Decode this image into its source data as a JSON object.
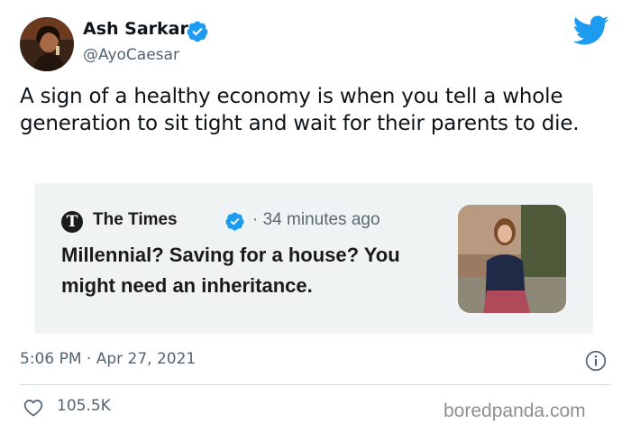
{
  "author": {
    "name": "Ash Sarkar",
    "handle": "@AyoCaesar",
    "verified_icon": "verified-badge-icon"
  },
  "platform_icon": "twitter-bird-icon",
  "tweet": {
    "text": "A sign of a healthy economy is when you tell a whole generation to sit tight and wait for their parents to die."
  },
  "embedded_card": {
    "source_logo_letter": "T",
    "source_name": "The Times",
    "time_ago": "· 34 minutes ago",
    "headline": "Millennial? Saving for a house? You might need an inheritance."
  },
  "meta": {
    "timestamp": "5:06 PM · Apr 27, 2021",
    "info_icon": "info-icon"
  },
  "actions": {
    "like_icon": "heart-icon",
    "like_count": "105.5K"
  },
  "watermark": "boredpanda.com",
  "colors": {
    "twitter_blue": "#1d9bf0",
    "text_primary": "#0f1419",
    "text_secondary": "#536471",
    "card_bg": "#eff3f4"
  }
}
